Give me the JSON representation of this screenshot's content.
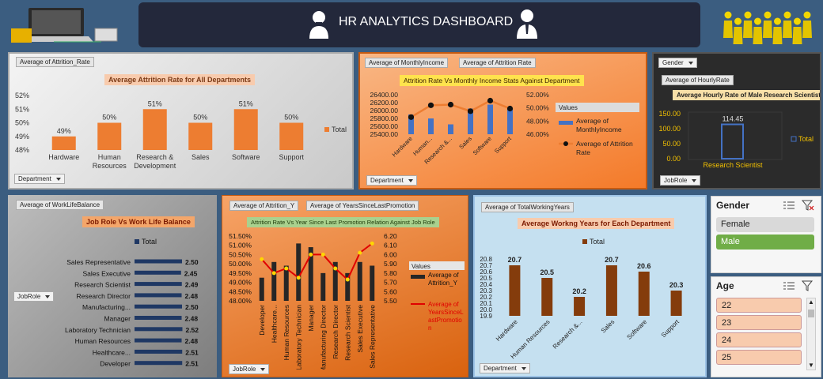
{
  "header": {
    "title": "HR ANALYTICS DASHBOARD"
  },
  "colors": {
    "background": "#3b5d80",
    "orange": "#ed7d31",
    "navy": "#1f3864",
    "brown": "#843c0c",
    "blue": "#4472c4",
    "green_sel": "#70ad47",
    "peach": "#f8cbad"
  },
  "panel1": {
    "field": "Average of Attrition_Rate",
    "title": "Average Attrition Rate for All Departments",
    "filter": "Department",
    "legend": "Total",
    "chart_data": {
      "type": "bar",
      "categories": [
        "Hardware",
        "Human Resources",
        "Research & Development",
        "Sales",
        "Software",
        "Support"
      ],
      "values": [
        49,
        50,
        51,
        50,
        51,
        50
      ],
      "data_labels": [
        "49%",
        "50%",
        "51%",
        "50%",
        "51%",
        "50%"
      ],
      "yticks": [
        "48%",
        "49%",
        "50%",
        "51%",
        "52%"
      ],
      "ylim": [
        48,
        52
      ]
    }
  },
  "panel2": {
    "fields": [
      "Average of MonthlyIncome",
      "Average of Attrition Rate"
    ],
    "title": "Attrition Rate Vs Monthly Income Stats Against Department",
    "filter": "Department",
    "legend_title": "Values",
    "legend_items": [
      "Average of MonthlyIncome",
      "Average of Attrition Rate"
    ],
    "chart_data": {
      "type": "bar+line",
      "categories": [
        "Hardware",
        "Human...",
        "Research &...",
        "Sales",
        "Software",
        "Support"
      ],
      "series": [
        {
          "name": "Average of MonthlyIncome",
          "values": [
            25900,
            25800,
            25650,
            26050,
            26150,
            26050
          ]
        },
        {
          "name": "Average of Attrition Rate",
          "values": [
            48.6,
            50.4,
            50.5,
            49.5,
            51.1,
            49.9
          ]
        }
      ],
      "yticks_left": [
        "25400.00",
        "25600.00",
        "25800.00",
        "26000.00",
        "26200.00",
        "26400.00"
      ],
      "ylim_left": [
        25400,
        26400
      ],
      "yticks_right": [
        "46.00%",
        "48.00%",
        "50.00%",
        "52.00%"
      ],
      "ylim_right": [
        46,
        52
      ]
    }
  },
  "panel3": {
    "filter_gender": "Gender",
    "field": "Average of HourlyRate",
    "title": "Average Hourly Rate of Male Research Scientist",
    "filter": "JobRole",
    "legend": "Total",
    "chart_data": {
      "type": "bar",
      "categories": [
        "Research Scientist"
      ],
      "values": [
        114.45
      ],
      "data_labels": [
        "114.45"
      ],
      "yticks": [
        "0.00",
        "50.00",
        "100.00",
        "150.00"
      ],
      "ylim": [
        0,
        150
      ]
    }
  },
  "panel4": {
    "field": "Average of WorkLifeBalance",
    "title": "Job Role Vs Work Life Balance",
    "legend": "Total",
    "filter": "JobRole",
    "chart_data": {
      "type": "hbar",
      "categories": [
        "Sales Representative",
        "Sales Executive",
        "Research Scientist",
        "Research Director",
        "Manufacturing...",
        "Manager",
        "Laboratory Technician",
        "Human Resources",
        "Healthcare...",
        "Developer"
      ],
      "values": [
        2.5,
        2.45,
        2.49,
        2.48,
        2.5,
        2.48,
        2.52,
        2.48,
        2.51,
        2.51
      ],
      "data_labels": [
        "2.50",
        "2.45",
        "2.49",
        "2.48",
        "2.50",
        "2.48",
        "2.52",
        "2.48",
        "2.51",
        "2.51"
      ]
    }
  },
  "panel5": {
    "fields": [
      "Average of Attrition_Y",
      "Average of YearsSinceLastPromotion"
    ],
    "title": "Attrition Rate Vs Year Since Last Promotion Relation Against Job Role",
    "filter": "JobRole",
    "legend_title": "Values",
    "legend_items": [
      "Average of Attrition_Y",
      "Average of YearsSinceLastPromotion"
    ],
    "chart_data": {
      "type": "bar+line",
      "categories": [
        "Developer",
        "Healthcare...",
        "Human Resources",
        "Laboratory Technician",
        "Manager",
        "Manufacturing Director",
        "Research Director",
        "Research Scientist",
        "Sales Executive",
        "Sales Representative"
      ],
      "series": [
        {
          "name": "Average of Attrition_Y",
          "values": [
            49.25,
            50.1,
            49.9,
            51.1,
            50.9,
            49.5,
            50.1,
            49.5,
            50.1,
            49.9
          ]
        },
        {
          "name": "Average of YearsSinceLastPromotion",
          "values": [
            5.95,
            5.8,
            5.85,
            5.75,
            6.0,
            6.0,
            5.85,
            5.73,
            6.02,
            6.12
          ]
        }
      ],
      "yticks_left": [
        "48.00%",
        "48.50%",
        "49.00%",
        "49.50%",
        "50.00%",
        "50.50%",
        "51.00%",
        "51.50%"
      ],
      "ylim_left": [
        48,
        51.5
      ],
      "yticks_right": [
        "5.50",
        "5.60",
        "5.70",
        "5.80",
        "5.90",
        "6.00",
        "6.10",
        "6.20"
      ],
      "ylim_right": [
        5.5,
        6.2
      ]
    }
  },
  "panel6": {
    "field": "Average of TotalWorkingYears",
    "title": "Average Workng Years for Each Department",
    "legend": "Total",
    "filter": "Department",
    "chart_data": {
      "type": "bar",
      "categories": [
        "Hardware",
        "Human Resources",
        "Research &...",
        "Sales",
        "Software",
        "Support"
      ],
      "values": [
        20.7,
        20.5,
        20.2,
        20.7,
        20.6,
        20.3
      ],
      "data_labels": [
        "20.7",
        "20.5",
        "20.2",
        "20.7",
        "20.6",
        "20.3"
      ],
      "yticks": [
        "19.9",
        "20.0",
        "20.1",
        "20.2",
        "20.3",
        "20.4",
        "20.5",
        "20.6",
        "20.7",
        "20.8"
      ],
      "ylim": [
        19.9,
        20.8
      ]
    }
  },
  "slicer_gender": {
    "title": "Gender",
    "items": [
      "Female",
      "Male"
    ],
    "selected": "Male"
  },
  "slicer_age": {
    "title": "Age",
    "items": [
      "22",
      "23",
      "24",
      "25"
    ]
  }
}
